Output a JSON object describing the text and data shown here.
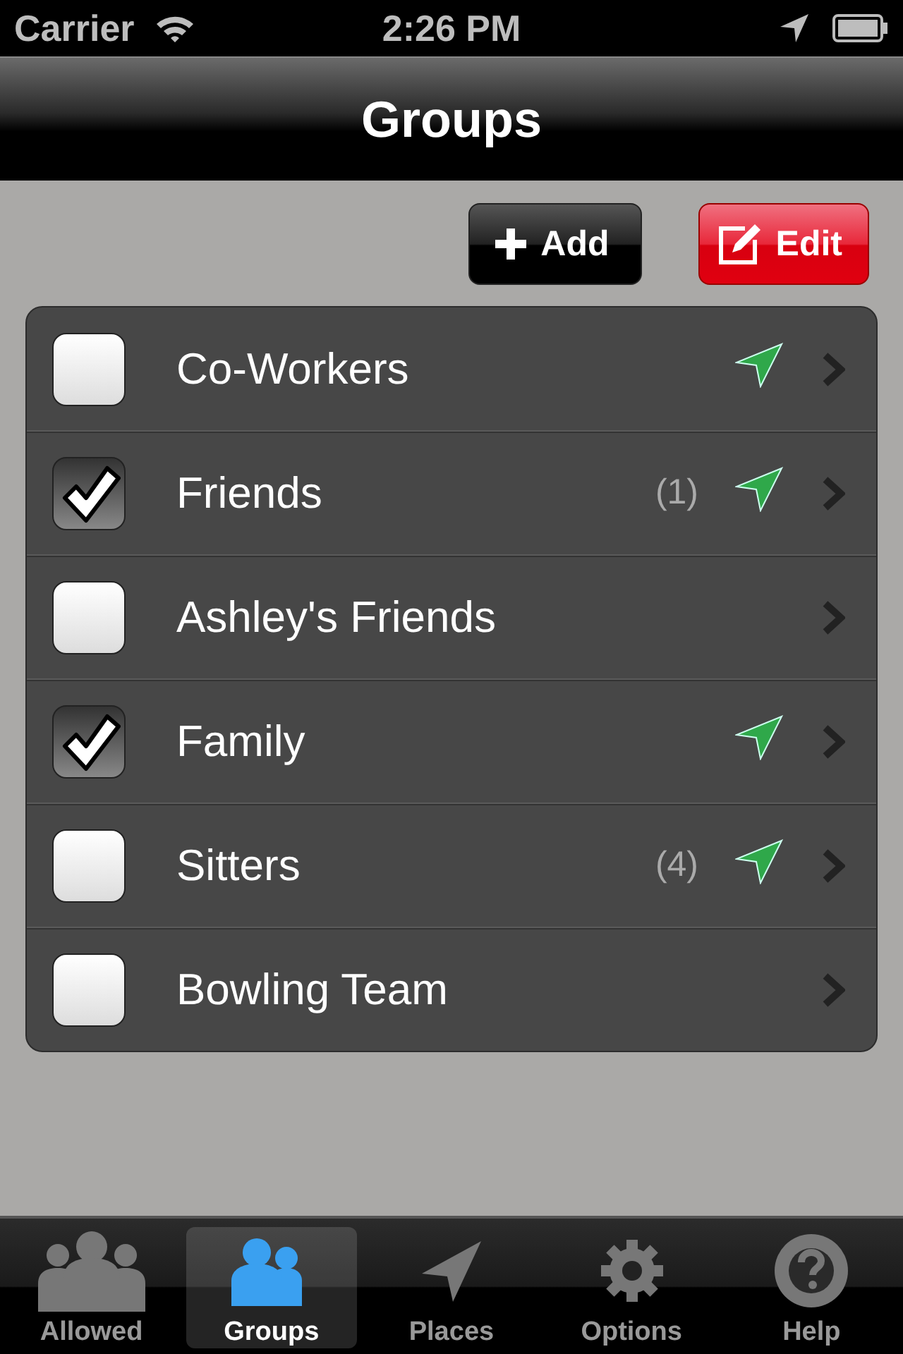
{
  "status_bar": {
    "carrier": "Carrier",
    "time": "2:26 PM"
  },
  "nav_bar": {
    "title": "Groups"
  },
  "toolbar": {
    "buttons": [
      {
        "label": "Add",
        "kind": "add"
      },
      {
        "label": "Edit",
        "kind": "edit"
      }
    ]
  },
  "groups": [
    {
      "name": "Co-Workers",
      "checked": false,
      "located": true
    },
    {
      "name": "Friends",
      "checked": true,
      "count": "(1)",
      "located": true
    },
    {
      "name": "Ashley's Friends",
      "checked": false,
      "located": false
    },
    {
      "name": "Family",
      "checked": true,
      "located": true
    },
    {
      "name": "Sitters",
      "checked": false,
      "count": "(4)",
      "located": true
    },
    {
      "name": "Bowling Team",
      "checked": false,
      "located": false
    }
  ],
  "tab_bar": [
    {
      "label": "Allowed",
      "kind": "people",
      "selected": false
    },
    {
      "label": "Groups",
      "kind": "group",
      "selected": true
    },
    {
      "label": "Places",
      "kind": "arrow",
      "selected": false
    },
    {
      "label": "Options",
      "kind": "gear",
      "selected": false
    },
    {
      "label": "Help",
      "kind": "help",
      "selected": false
    }
  ]
}
